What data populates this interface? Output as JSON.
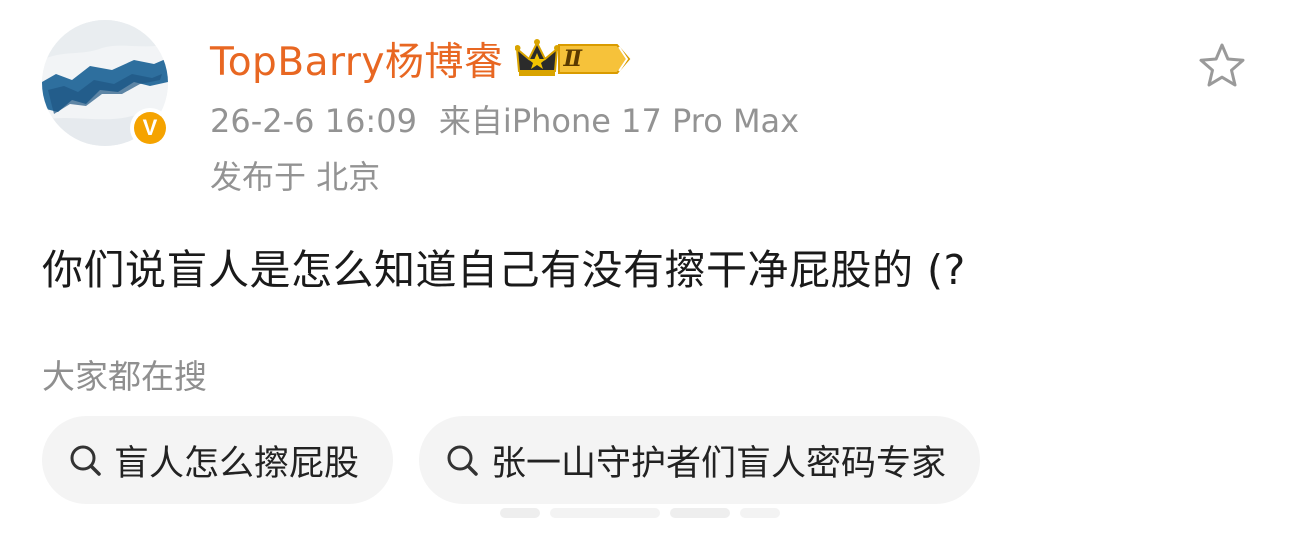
{
  "post": {
    "author": {
      "name": "TopBarry杨博睿",
      "level_badge": "Ⅱ",
      "verified_icon": "v-badge-icon",
      "verified_mark": "V"
    },
    "meta": {
      "timestamp": "26-2-6 16:09",
      "source": "来自iPhone 17 Pro Max",
      "location": "发布于 北京"
    },
    "content": "你们说盲人是怎么知道自己有没有擦干净屁股的 (?",
    "favorite_icon": "star-outline-icon"
  },
  "related_searches": {
    "title": "大家都在搜",
    "items": [
      {
        "label": "盲人怎么擦屁股",
        "icon": "search-icon"
      },
      {
        "label": "张一山守护者们盲人密码专家",
        "icon": "search-icon"
      }
    ]
  },
  "colors": {
    "username": "#e86722",
    "meta": "#939393",
    "body_text": "#1a1a1a",
    "chip_bg": "#f4f4f4",
    "verified": "#f5a300",
    "crown_gold": "#d9a400"
  }
}
